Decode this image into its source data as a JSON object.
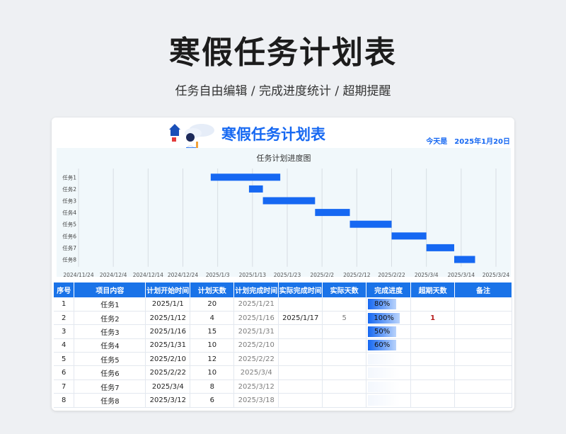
{
  "hero": {
    "title": "寒假任务计划表",
    "subtitle": "任务自由编辑 / 完成进度统计 / 超期提醒"
  },
  "sheet": {
    "title": "寒假任务计划表",
    "today_label": "今天是",
    "today_value": "2025年1月20日"
  },
  "chart_data": {
    "type": "gantt",
    "title": "任务计划进度图",
    "bar_color": "#1668f2",
    "x_ticks": [
      "2024/11/24",
      "2024/12/4",
      "2024/12/14",
      "2024/12/24",
      "2025/1/3",
      "2025/1/13",
      "2025/1/23",
      "2025/2/2",
      "2025/2/12",
      "2025/2/22",
      "2025/3/4",
      "2025/3/14",
      "2025/3/24"
    ],
    "xlim": [
      "2024/11/24",
      "2025/3/24"
    ],
    "grid": true,
    "tasks": [
      {
        "name": "任务1",
        "start": "2025/1/1",
        "end": "2025/1/21"
      },
      {
        "name": "任务2",
        "start": "2025/1/12",
        "end": "2025/1/16"
      },
      {
        "name": "任务3",
        "start": "2025/1/16",
        "end": "2025/1/31"
      },
      {
        "name": "任务4",
        "start": "2025/1/31",
        "end": "2025/2/10"
      },
      {
        "name": "任务5",
        "start": "2025/2/10",
        "end": "2025/2/22"
      },
      {
        "name": "任务6",
        "start": "2025/2/22",
        "end": "2025/3/4"
      },
      {
        "name": "任务7",
        "start": "2025/3/4",
        "end": "2025/3/12"
      },
      {
        "name": "任务8",
        "start": "2025/3/12",
        "end": "2025/3/18"
      }
    ]
  },
  "table": {
    "headers": [
      "序号",
      "项目内容",
      "计划开始时间",
      "计划天数",
      "计划完成时间",
      "实际完成时间",
      "实际天数",
      "完成进度",
      "超期天数",
      "备注"
    ],
    "rows": [
      {
        "no": "1",
        "item": "任务1",
        "start": "2025/1/1",
        "days": "20",
        "end": "2025/1/21",
        "actual_end": "",
        "actual_days": "",
        "progress": "80%",
        "progress_value": 80,
        "overdue": "",
        "note": ""
      },
      {
        "no": "2",
        "item": "任务2",
        "start": "2025/1/12",
        "days": "4",
        "end": "2025/1/16",
        "actual_end": "2025/1/17",
        "actual_days": "5",
        "progress": "100%",
        "progress_value": 100,
        "overdue": "1",
        "note": ""
      },
      {
        "no": "3",
        "item": "任务3",
        "start": "2025/1/16",
        "days": "15",
        "end": "2025/1/31",
        "actual_end": "",
        "actual_days": "",
        "progress": "50%",
        "progress_value": 50,
        "overdue": "",
        "note": ""
      },
      {
        "no": "4",
        "item": "任务4",
        "start": "2025/1/31",
        "days": "10",
        "end": "2025/2/10",
        "actual_end": "",
        "actual_days": "",
        "progress": "60%",
        "progress_value": 60,
        "overdue": "",
        "note": ""
      },
      {
        "no": "5",
        "item": "任务5",
        "start": "2025/2/10",
        "days": "12",
        "end": "2025/2/22",
        "actual_end": "",
        "actual_days": "",
        "progress": "",
        "progress_value": 0,
        "overdue": "",
        "note": ""
      },
      {
        "no": "6",
        "item": "任务6",
        "start": "2025/2/22",
        "days": "10",
        "end": "2025/3/4",
        "actual_end": "",
        "actual_days": "",
        "progress": "",
        "progress_value": 0,
        "overdue": "",
        "note": ""
      },
      {
        "no": "7",
        "item": "任务7",
        "start": "2025/3/4",
        "days": "8",
        "end": "2025/3/12",
        "actual_end": "",
        "actual_days": "",
        "progress": "",
        "progress_value": 0,
        "overdue": "",
        "note": ""
      },
      {
        "no": "8",
        "item": "任务8",
        "start": "2025/3/12",
        "days": "6",
        "end": "2025/3/18",
        "actual_end": "",
        "actual_days": "",
        "progress": "",
        "progress_value": 0,
        "overdue": "",
        "note": ""
      }
    ]
  },
  "colors": {
    "accent": "#1668f2",
    "header_bg": "#1a73e8",
    "overdue": "#b71c1c"
  }
}
